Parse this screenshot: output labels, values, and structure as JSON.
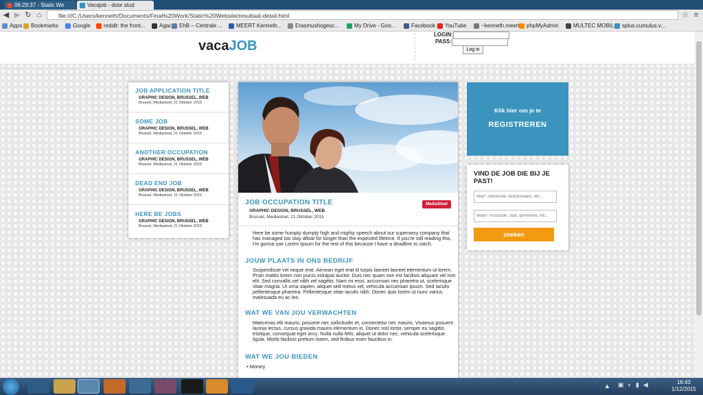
{
  "browser": {
    "tabs": [
      {
        "label": "06:29:37 - Static We"
      },
      {
        "label": "Vacajob - door stud"
      }
    ],
    "url": "file:///C:/Users/kenneth/Documents/Final%20Work/Static%20Website/resultaat-detail.html",
    "bookmarks": [
      "Apps",
      "Bookmarks",
      "Google",
      "reddit: the front...",
      "Agar.io",
      "EhB – Centrale ...",
      "MEERT Kenneth...",
      "Erasmushogesc...",
      "My Drive - Goo...",
      "Facebook",
      "YouTube",
      "~kenneth.meert",
      "phpMyAdmin",
      "MULTEC MOBIL...",
      "splus.cumulus.v..."
    ]
  },
  "site": {
    "logo_a": "vaca",
    "logo_b": "JOB",
    "login_label": "LOGIN:",
    "pass_label": "PASS:",
    "login_button": "Log in"
  },
  "jobs": [
    {
      "title": "JOB APPLICATION TITLE",
      "cat": "GRAPHIC DESIGN, BRUSSEL, WEB",
      "loc": "Brussel, Mediastoel, 21 Oktober 2015"
    },
    {
      "title": "SOME JOB",
      "cat": "GRAPHIC DESIGN, BRUSSEL, WEB",
      "loc": "Brussel, Mediastoel, 21 Oktober 2015"
    },
    {
      "title": "ANOTHER OCCUPATION",
      "cat": "GRAPHIC DESIGN, BRUSSEL, WEB",
      "loc": "Brussel, Mediastoel, 21 Oktober 2015"
    },
    {
      "title": "DEAD END JOB",
      "cat": "GRAPHIC DESIGN, BRUSSEL, WEB",
      "loc": "Brussel, Mediastoel, 21 Oktober 2015"
    },
    {
      "title": "HERE BE JOBS",
      "cat": "GRAPHIC DESIGN, BRUSSEL, WEB",
      "loc": "Brussel, Mediastoel, 21 Oktober 2015"
    }
  ],
  "detail": {
    "title": "JOB OCCUPATION TITLE",
    "cat": "GRAPHIC DESIGN, BRUSSEL, WEB",
    "loc": "Brussel, Mediastoel, 21 Oktober 2015",
    "badge": "MediaStoel",
    "intro": "Here be some humpty dumpty high and mighty speech about our supersexy company that has managed too stay afloat for longer than the expected lifetime. If you're still reading this, I'm gonna use Lorem Ipsum for the rest of this because I have a deadline to catch.",
    "sec1": "JOUW PLAATS IN ONS BEDRIJF",
    "p1": "Suspendisse vel neque erat. Aenean eget erat id turpis laoreet laoreet elementum ut lorem. Proin mattis lorem non purus volutpat auctor. Duis nec quam non est facilisis aliquam vel non elit. Sed convallis vel nibh vel sagittis. Nam mi eros, accumsan nec pharetra ut, scelerisque vitae magna. Ut urna sapien, aliquet sed metus vel, vehicula accumsan ipsum. Sed iaculis pellentesque pharetra. Pellentesque vitae iaculis nibh. Donec quis lorem ut nunc varius malesuada eu ac leo.",
    "sec2": "WAT WE VAN JOU VERWACHTEN",
    "p2": "Maecenas elit mauris, posuere nec sollicitudin et, consectetur nec mauris. Vivamus posuere lacinia lectus, cursus gravida mauris elementum in. Donec nisl tortor, semper eu sagittis tristique, consequat eget arcu. Nulla nulla felis, aliquet ut dolor nec, vehicula scelerisque ligula. Morbi facilisis pretium lorem, sed finibus enim faucibus in.",
    "sec3": "WAT WE JOU BIEDEN",
    "bullet": "Money"
  },
  "register": {
    "line1": "Klik hier om je te",
    "line2": "REGISTREREN"
  },
  "search": {
    "heading": "VIND DE JOB DIE BIJ JE PAST!",
    "ph1": "Wat? Jobfunctie, bedrijfsnaam, etc...",
    "ph2": "Waar? Postcode, stad, gemeente, etc...",
    "button": "zoeken"
  },
  "taskbar": {
    "time": "16:43",
    "date": "1/12/2015"
  }
}
